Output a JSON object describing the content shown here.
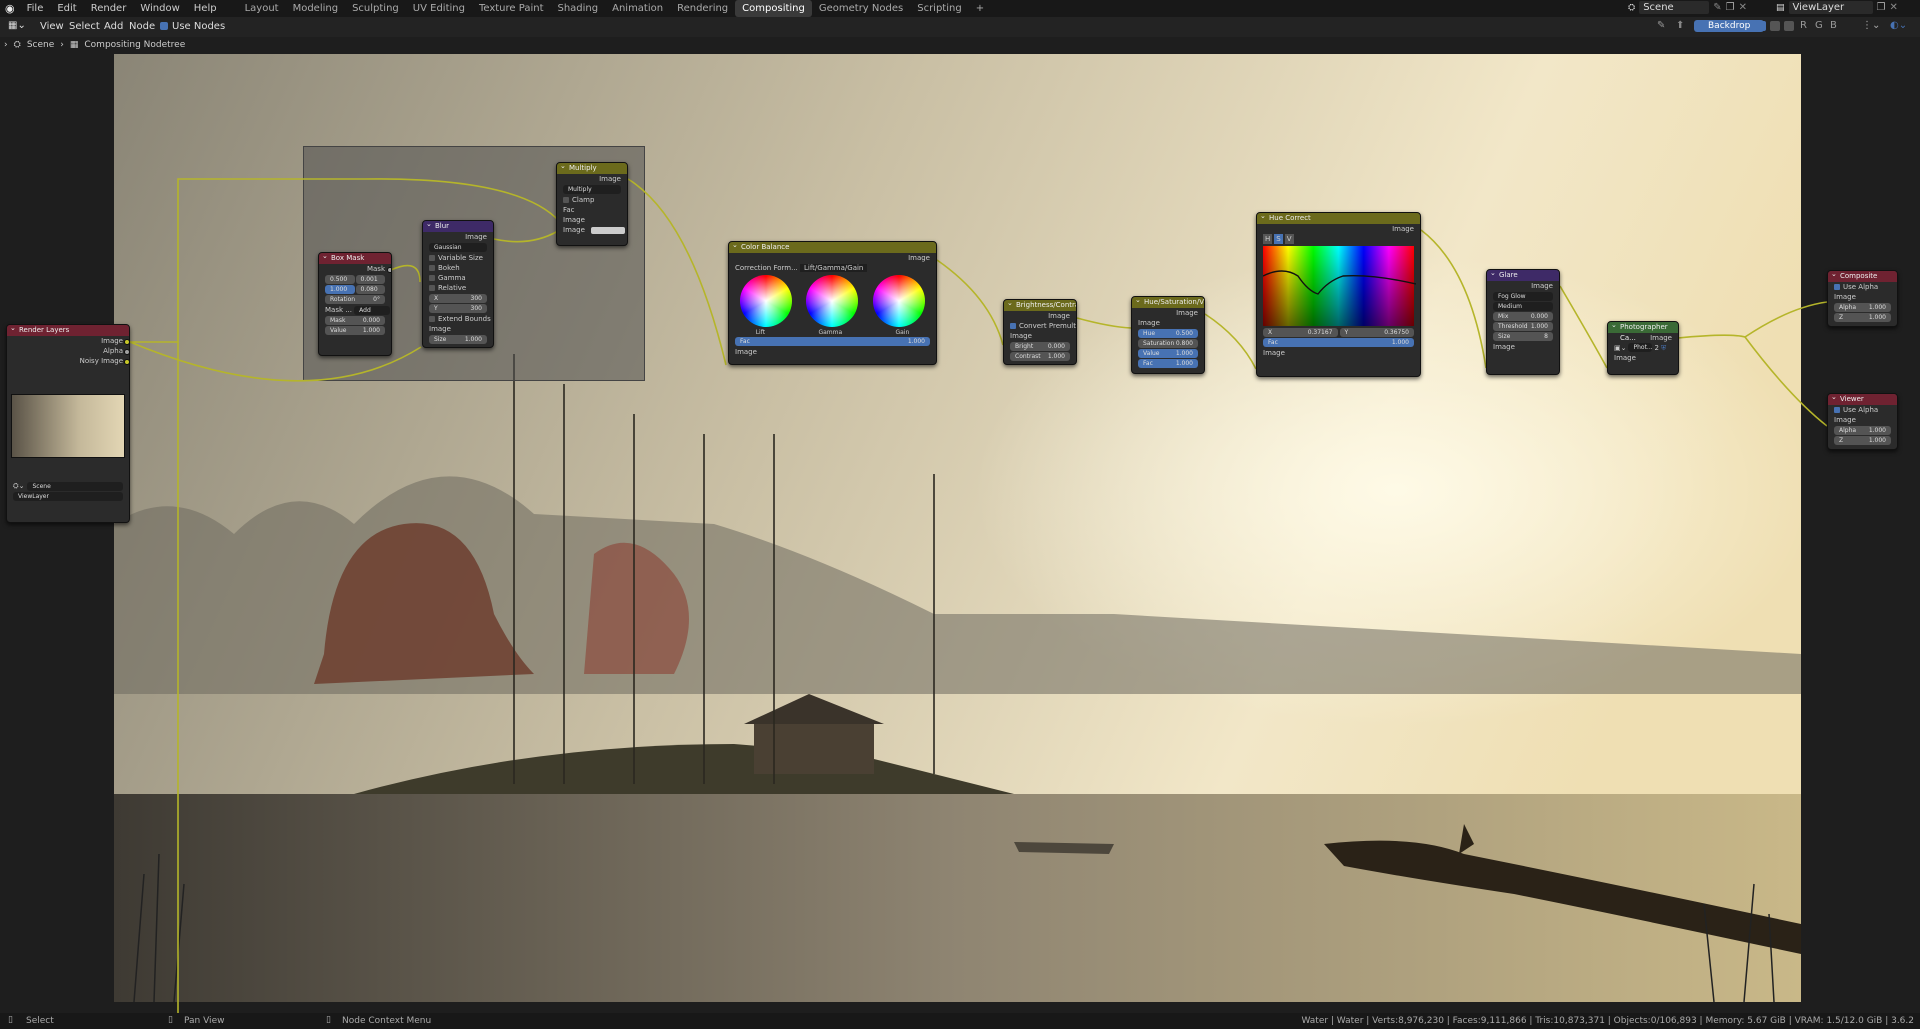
{
  "menu": [
    "File",
    "Edit",
    "Render",
    "Window",
    "Help"
  ],
  "workspaces": [
    "Layout",
    "Modeling",
    "Sculpting",
    "UV Editing",
    "Texture Paint",
    "Shading",
    "Animation",
    "Rendering",
    "Compositing",
    "Geometry Nodes",
    "Scripting"
  ],
  "active_workspace": "Compositing",
  "add_tab": "+",
  "scene_field": "Scene",
  "viewlayer_field": "ViewLayer",
  "toolbar": {
    "view": "View",
    "select": "Select",
    "add": "Add",
    "node": "Node",
    "use_nodes": "Use Nodes",
    "backdrop": "Backdrop",
    "channels": [
      "R",
      "G",
      "B"
    ]
  },
  "breadcrumb": {
    "scene": "Scene",
    "tree": "Compositing Nodetree"
  },
  "nodes": {
    "render_layers": {
      "title": "Render Layers",
      "outputs": [
        "Image",
        "Alpha",
        "Noisy Image"
      ],
      "scene": "Scene",
      "layer": "ViewLayer"
    },
    "box_mask": {
      "title": "Box Mask",
      "out": "Mask",
      "x": "0.500",
      "y": "0.001",
      "w": "1.000",
      "h": "0.080",
      "rotation": "Rotation",
      "rot_val": "0°",
      "mask_type_label": "Mask ...",
      "mask_type": "Add",
      "in_mask": "Mask",
      "mask_val": "0.000",
      "in_value": "Value",
      "value_val": "1.000"
    },
    "blur": {
      "title": "Blur",
      "out": "Image",
      "type": "Gaussian",
      "opts": [
        "Variable Size",
        "Bokeh",
        "Gamma",
        "Relative"
      ],
      "x_label": "X",
      "x": "300",
      "y_label": "Y",
      "y": "300",
      "extend": "Extend Bounds",
      "in_image": "Image",
      "size_label": "Size",
      "size": "1.000"
    },
    "multiply": {
      "title": "Multiply",
      "out": "Image",
      "op": "Multiply",
      "clamp": "Clamp",
      "ins": [
        "Fac",
        "Image",
        "Image"
      ]
    },
    "color_balance": {
      "title": "Color Balance",
      "out": "Image",
      "formula_label": "Correction Form...",
      "formula": "Lift/Gamma/Gain",
      "wheels": [
        "Lift",
        "Gamma",
        "Gain"
      ],
      "fac": "Fac",
      "fac_val": "1.000",
      "in": "Image"
    },
    "brightness": {
      "title": "Brightness/Contrast",
      "out": "Image",
      "premult": "Convert Premultip...",
      "in": "Image",
      "bright": "Bright",
      "bright_val": "0.000",
      "contrast": "Contrast",
      "contrast_val": "1.000"
    },
    "hsv": {
      "title": "Hue/Saturation/Value",
      "out": "Image",
      "in": "Image",
      "hue": "Hue",
      "hue_val": "0.500",
      "sat": "Saturation",
      "sat_val": "0.800",
      "val": "Value",
      "val_val": "1.000",
      "fac": "Fac",
      "fac_val": "1.000"
    },
    "hue_correct": {
      "title": "Hue Correct",
      "out": "Image",
      "tabs": [
        "H",
        "S",
        "V"
      ],
      "x_label": "X",
      "x": "0.37167",
      "y_label": "Y",
      "y": "0.36750",
      "fac": "Fac",
      "fac_val": "1.000",
      "in": "Image"
    },
    "glare": {
      "title": "Glare",
      "out": "Image",
      "type": "Fog Glow",
      "quality": "Medium",
      "mix": "Mix",
      "mix_val": "0.000",
      "threshold": "Threshold",
      "threshold_val": "1.000",
      "size": "Size",
      "size_val": "8",
      "in": "Image"
    },
    "photographer": {
      "title": "Photographer Ca...",
      "out": "Image",
      "field": "Phot...",
      "num": "2",
      "in": "Image"
    },
    "composite": {
      "title": "Composite",
      "use_alpha": "Use Alpha",
      "in": "Image",
      "alpha": "Alpha",
      "alpha_val": "1.000",
      "z": "Z",
      "z_val": "1.000"
    },
    "viewer": {
      "title": "Viewer",
      "use_alpha": "Use Alpha",
      "in": "Image",
      "alpha": "Alpha",
      "alpha_val": "1.000",
      "z": "Z",
      "z_val": "1.000"
    }
  },
  "status": {
    "select": "Select",
    "pan": "Pan View",
    "context": "Node Context Menu",
    "info": "Water | Water | Verts:8,976,230 | Faces:9,111,866 | Tris:10,873,371 | Objects:0/106,893 | Memory: 5.67 GiB | VRAM: 1.5/12.0 GiB | 3.6.2"
  },
  "colors": {
    "link": "#b5b52a",
    "socket_color": "#c7c729",
    "active_tab": "#3a3a3a",
    "accent": "#4772b3"
  }
}
